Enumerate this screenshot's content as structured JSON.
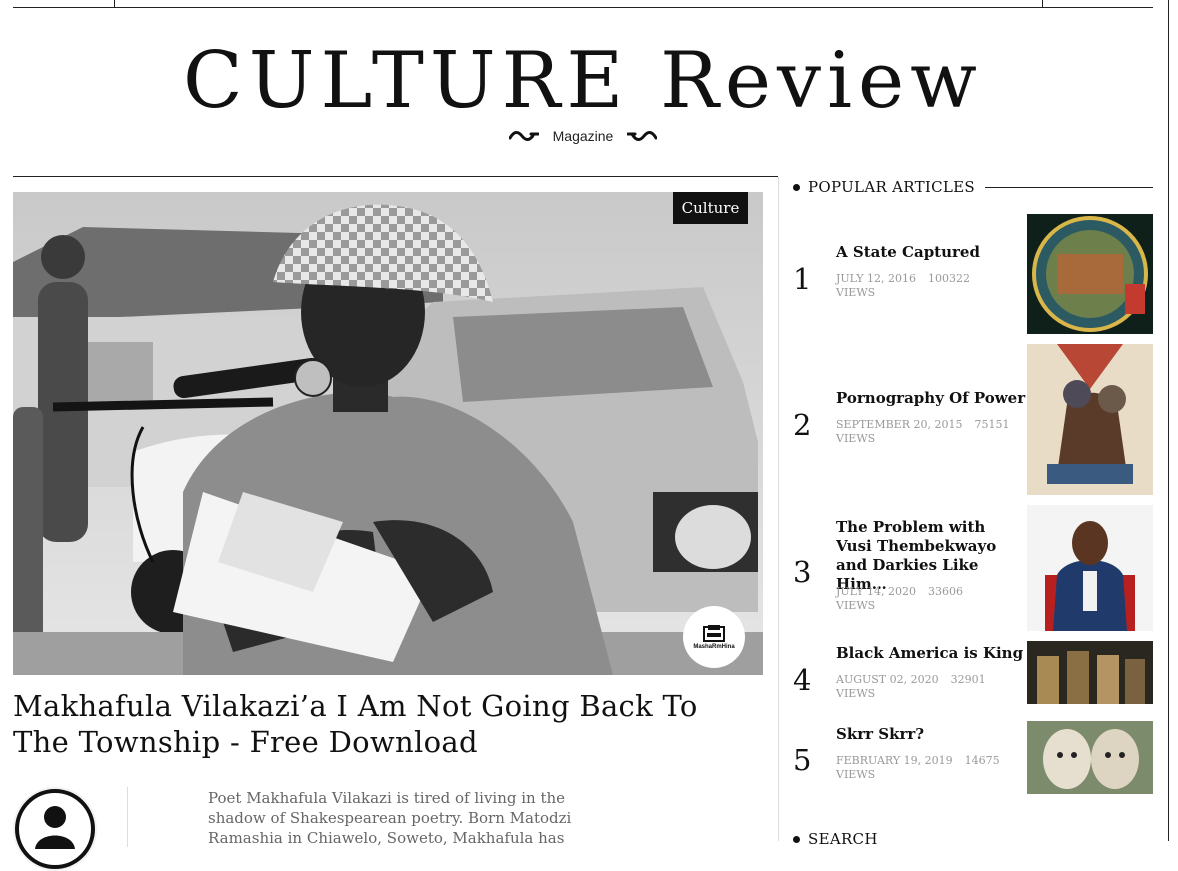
{
  "site": {
    "title": "CULTURE Review",
    "tagline": "Magazine"
  },
  "hero": {
    "category": "Culture",
    "source_logo_text": "MashaRmHina",
    "headline": "Makhafula Vilakazi’a I Am Not Going Back To The Township - Free Download",
    "excerpt": "Poet Makhafula Vilakazi is tired of living in the shadow of Shakespearean poetry. Born Matodzi Ramashia in Chiawelo, Soweto, Makhafula has"
  },
  "sidebar": {
    "popular_title": "POPULAR ARTICLES",
    "search_title": "SEARCH",
    "articles": [
      {
        "rank": "1",
        "title": "A State Captured",
        "date": "JULY 12, 2016",
        "views": "100322",
        "views_label": "VIEWS"
      },
      {
        "rank": "2",
        "title": "Pornography Of Power",
        "date": "SEPTEMBER 20, 2015",
        "views": "75151",
        "views_label": "VIEWS"
      },
      {
        "rank": "3",
        "title": "The Problem with Vusi Thembekwayo and Darkies Like Him…",
        "date": "JULY 14, 2020",
        "views": "33606",
        "views_label": "VIEWS"
      },
      {
        "rank": "4",
        "title": "Black America is King",
        "date": "AUGUST 02, 2020",
        "views": "32901",
        "views_label": "VIEWS"
      },
      {
        "rank": "5",
        "title": "Skrr Skrr?",
        "date": "FEBRUARY 19, 2019",
        "views": "14675",
        "views_label": "VIEWS"
      }
    ]
  },
  "colors": {
    "text": "#111111",
    "meta": "#999999",
    "excerpt": "#666666",
    "rule": "#222222"
  }
}
